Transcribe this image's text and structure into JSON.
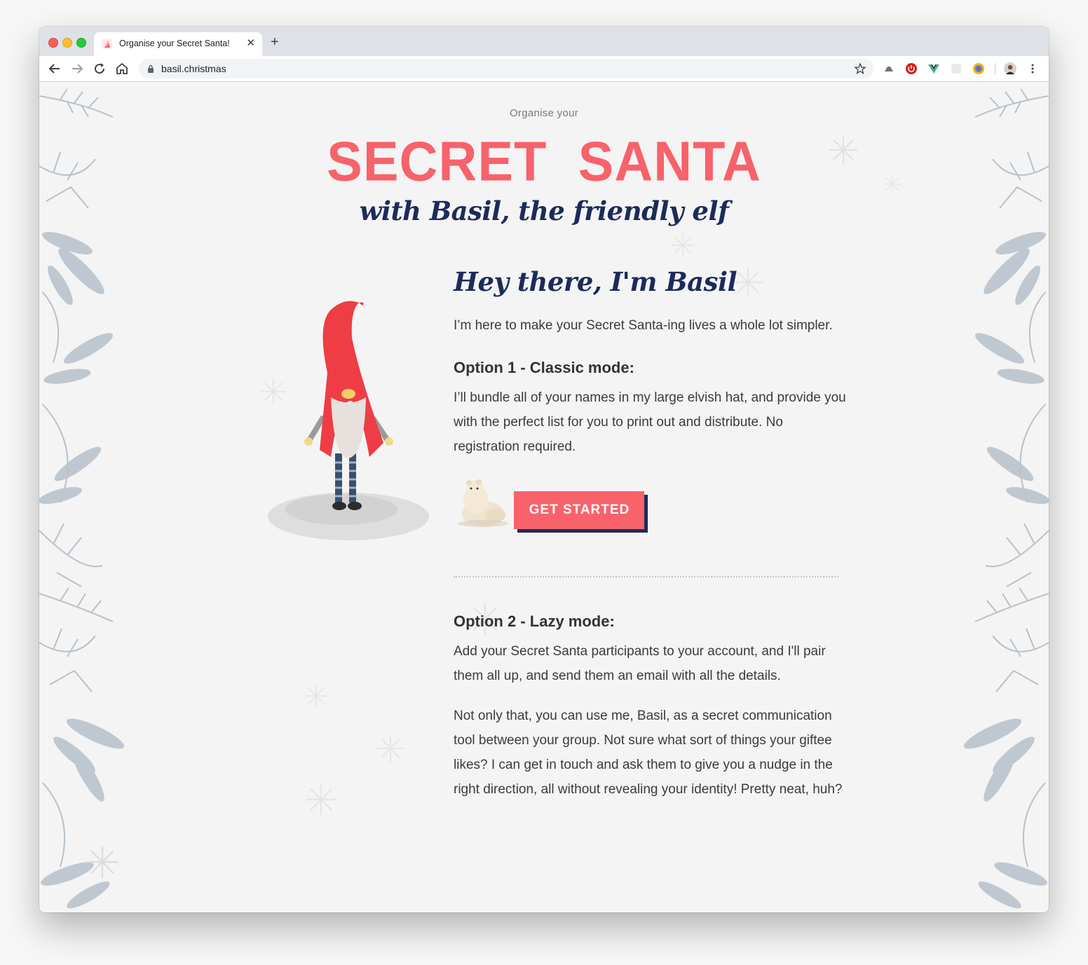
{
  "browser": {
    "tab_title": "Organise your Secret Santa!",
    "tab_close": "✕",
    "new_tab": "+",
    "url": "basil.christmas"
  },
  "hero": {
    "eyebrow": "Organise your",
    "title": "SECRET  SANTA",
    "subtitle": "with Basil, the friendly elf"
  },
  "intro": {
    "greeting": "Hey there, I'm Basil",
    "text": "I’m here to make your Secret Santa-ing lives a whole lot simpler."
  },
  "option1": {
    "heading": "Option 1 - Classic mode:",
    "text": "I’ll bundle all of your names in my large elvish hat, and provide you with the perfect list for you to print out and distribute. No registration required.",
    "button_label": "GET STARTED"
  },
  "option2": {
    "heading": "Option 2 - Lazy mode:",
    "text1": "Add your Secret Santa participants to your account, and I'll pair them all up, and send them an email with all the details.",
    "text2": "Not only that, you can use me, Basil, as a secret communication tool between your group. Not sure what sort of things your giftee likes? I can get in touch and ask them to give you a nudge in the right direction, all without revealing your identity! Pretty neat, huh?"
  },
  "colors": {
    "accent": "#f8626a",
    "navy": "#1c2b5a",
    "foliage": "#b9c3cc"
  },
  "icons": [
    "back-icon",
    "forward-icon",
    "reload-icon",
    "home-icon",
    "lock-icon",
    "star-icon",
    "profile-avatar"
  ]
}
